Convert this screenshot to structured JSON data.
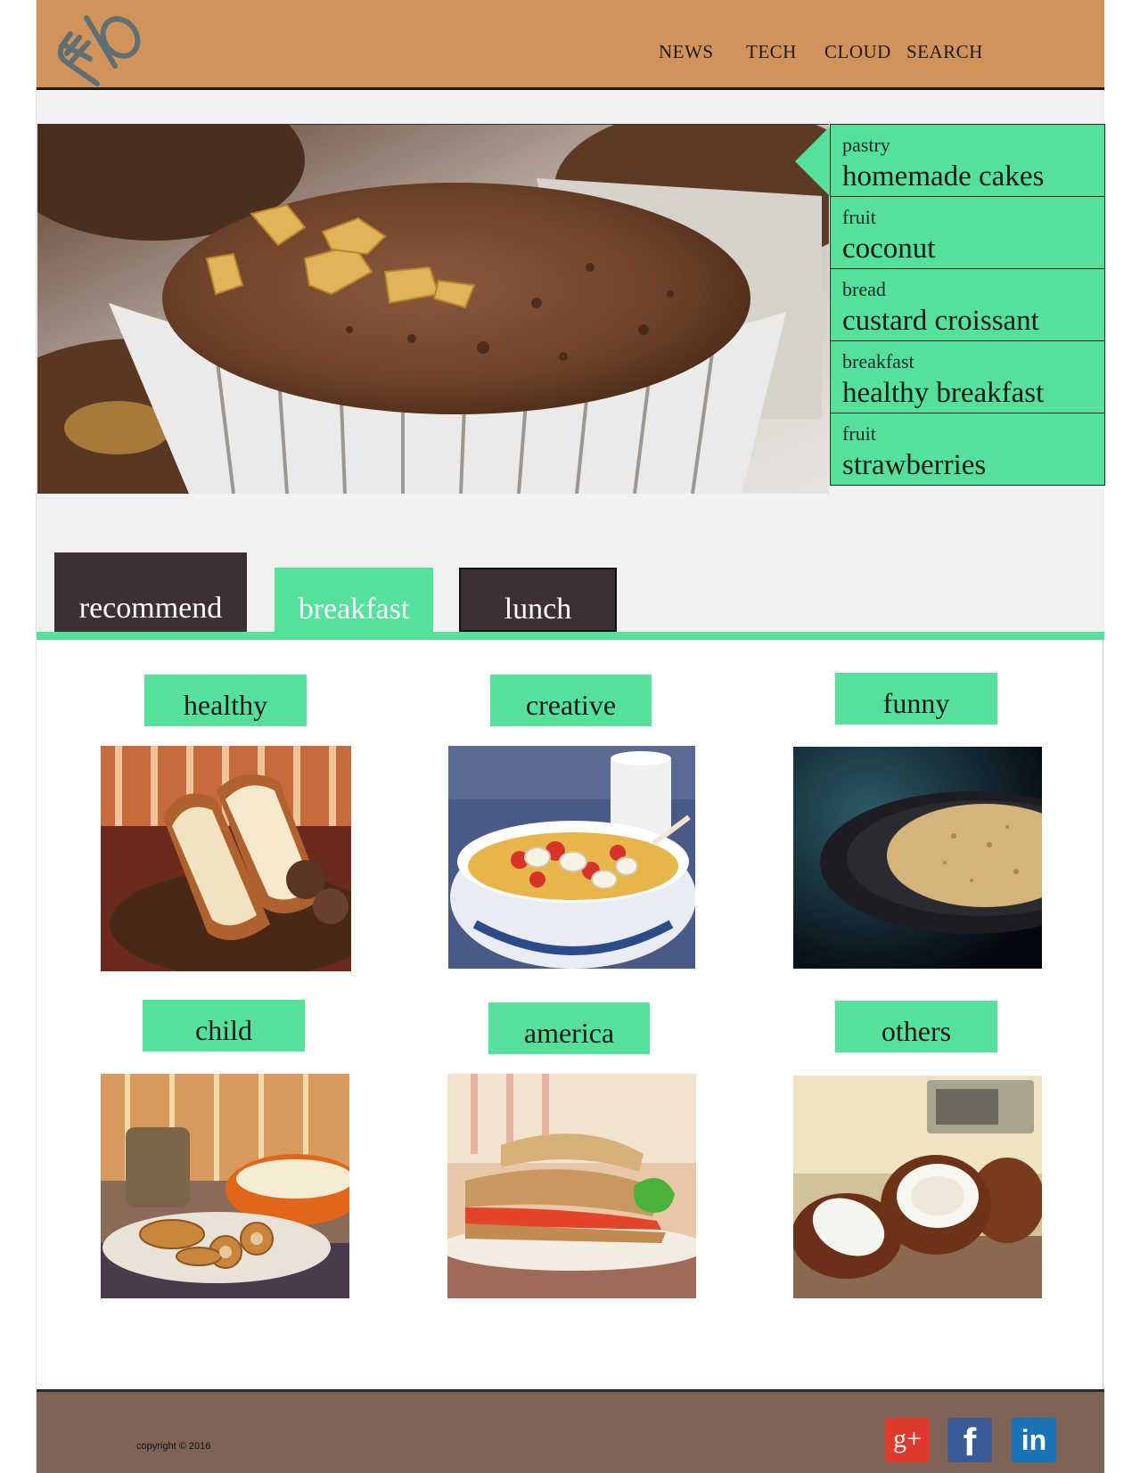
{
  "header": {
    "nav": [
      {
        "label": "NEWS"
      },
      {
        "label": "TECH"
      },
      {
        "label": "CLOUD"
      },
      {
        "label": "SEARCH"
      }
    ]
  },
  "featured": {
    "items": [
      {
        "category": "pastry",
        "title": "homemade cakes"
      },
      {
        "category": "fruit",
        "title": "coconut"
      },
      {
        "category": "bread",
        "title": "custard croissant"
      },
      {
        "category": "breakfast",
        "title": "healthy breakfast"
      },
      {
        "category": "fruit",
        "title": "strawberries"
      }
    ]
  },
  "tabs": {
    "recommend": "recommend",
    "breakfast": "breakfast",
    "lunch": "lunch",
    "active": "breakfast"
  },
  "grid": {
    "cards": [
      {
        "label": "healthy",
        "image": "bread-basket"
      },
      {
        "label": "creative",
        "image": "cereal-bowl"
      },
      {
        "label": "funny",
        "image": "crepe-pan"
      },
      {
        "label": "child",
        "image": "snack-plate"
      },
      {
        "label": "america",
        "image": "sandwich"
      },
      {
        "label": "others",
        "image": "coconuts"
      }
    ]
  },
  "footer": {
    "copyright": "copyright © 2016",
    "social": {
      "google": "g+",
      "facebook": "f",
      "linkedin": "in"
    }
  },
  "colors": {
    "header": "#d2935b",
    "accent": "#55e19b",
    "tab_dark": "#3e2f37",
    "footer": "#7e6356"
  }
}
